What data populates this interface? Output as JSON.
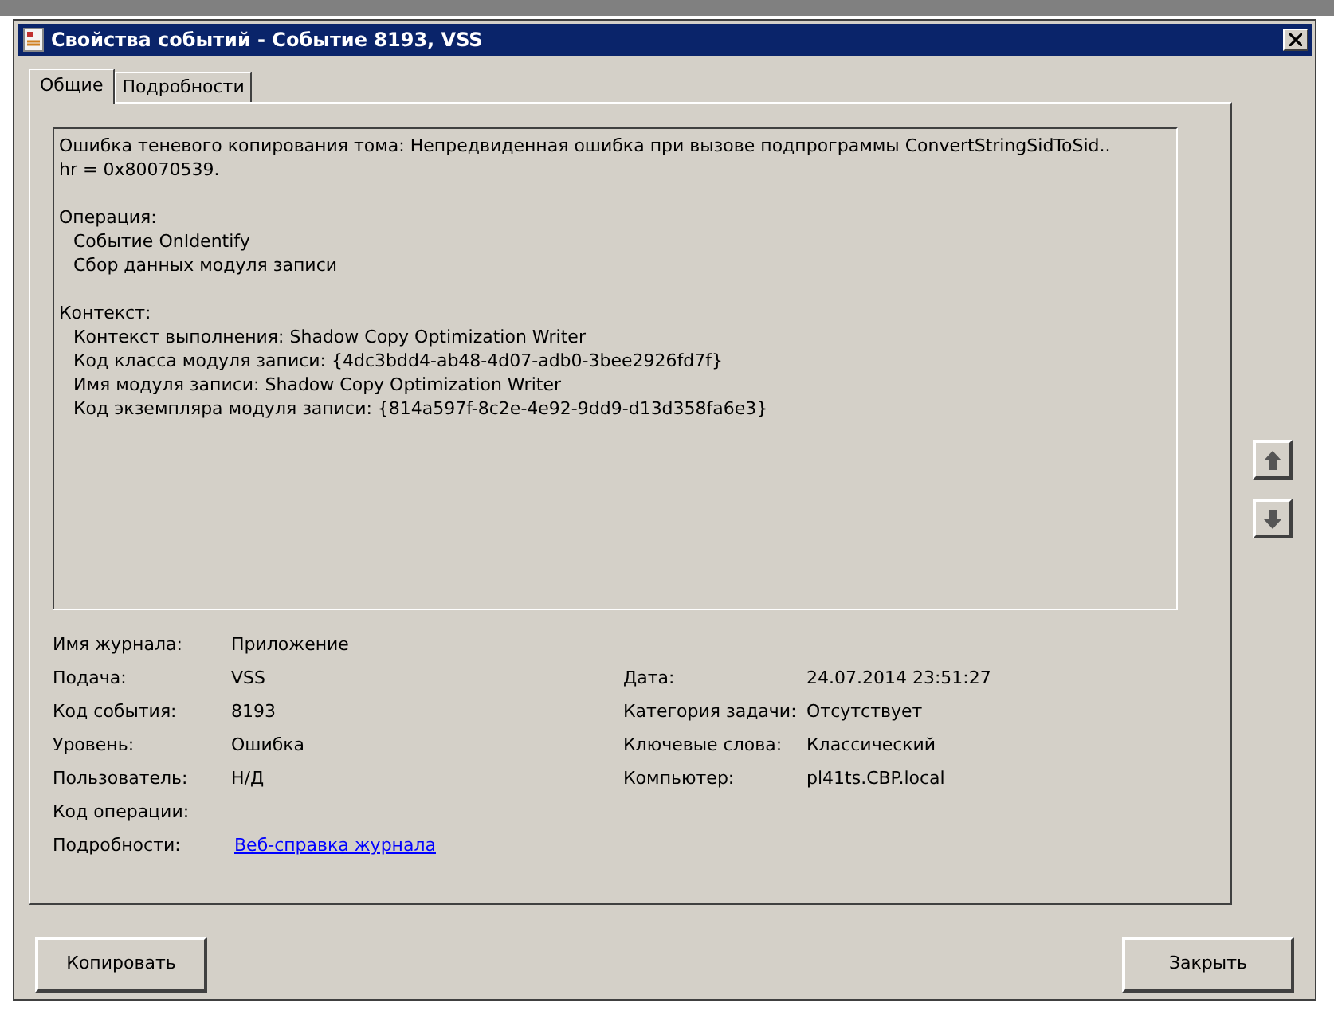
{
  "window": {
    "title": "Свойства событий - Событие 8193, VSS"
  },
  "tabs": [
    {
      "label": "Общие",
      "selected": true
    },
    {
      "label": "Подробности",
      "selected": false
    }
  ],
  "description": {
    "message": "Ошибка теневого копирования тома: Непредвиденная ошибка при вызове подпрограммы ConvertStringSidToSid.. hr = 0x80070539.",
    "sections": [
      {
        "heading": "Операция:",
        "items": [
          "Событие OnIdentify",
          "Сбор данных модуля записи"
        ]
      },
      {
        "heading": "Контекст:",
        "items": [
          "Контекст выполнения: Shadow Copy Optimization Writer",
          "Код класса модуля записи: {4dc3bdd4-ab48-4d07-adb0-3bee2926fd7f}",
          "Имя модуля записи: Shadow Copy Optimization Writer",
          "Код экземпляра модуля записи: {814a597f-8c2e-4e92-9dd9-d13d358fa6e3}"
        ]
      }
    ]
  },
  "fields": [
    {
      "label": "Имя журнала:",
      "value": "Приложение",
      "kind": "text"
    },
    {
      "label": "Подача:",
      "value": "VSS",
      "kind": "text",
      "right": {
        "label": "Дата:",
        "value": "24.07.2014 23:51:27"
      }
    },
    {
      "label": "Код события:",
      "value": "8193",
      "kind": "text",
      "right": {
        "label": "Категория задачи:",
        "value": "Отсутствует"
      }
    },
    {
      "label": "Уровень:",
      "value": "Ошибка",
      "kind": "text",
      "right": {
        "label": "Ключевые слова:",
        "value": "Классический"
      }
    },
    {
      "label": "Пользователь:",
      "value": "Н/Д",
      "kind": "text",
      "right": {
        "label": "Компьютер:",
        "value": "pl41ts.CBP.local"
      }
    },
    {
      "label": "Код операции:",
      "kind": "text"
    },
    {
      "label": "Подробности:",
      "value": "Веб-справка журнала",
      "kind": "link"
    }
  ],
  "buttons": [
    "Копировать",
    "Закрыть"
  ]
}
